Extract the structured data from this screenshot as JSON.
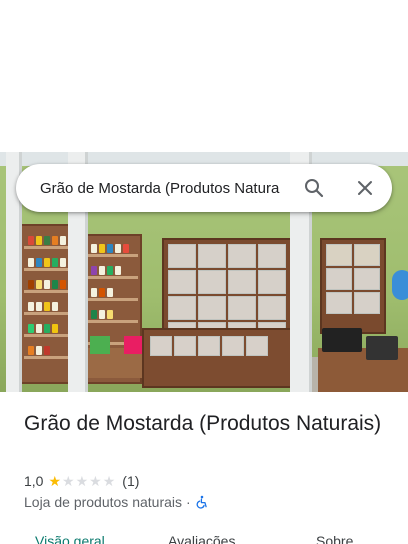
{
  "search": {
    "query": "Grão de Mostarda (Produtos Natura",
    "search_icon": "search-icon",
    "close_icon": "close-icon"
  },
  "place": {
    "name": "Grão de Mostarda (Produtos Naturais)",
    "rating": "1,0",
    "stars_filled": 1,
    "stars_total": 5,
    "review_count": "(1)",
    "category": "Loja de produtos naturais",
    "separator": "·",
    "accessibility_icon": "wheelchair-icon"
  },
  "tabs": [
    {
      "label": "Visão geral"
    },
    {
      "label": "Avaliações"
    },
    {
      "label": "Sobre"
    }
  ],
  "colors": {
    "star": "#fbbc04",
    "active_tab": "#0b7a6e",
    "accessibility": "#1a73e8"
  }
}
